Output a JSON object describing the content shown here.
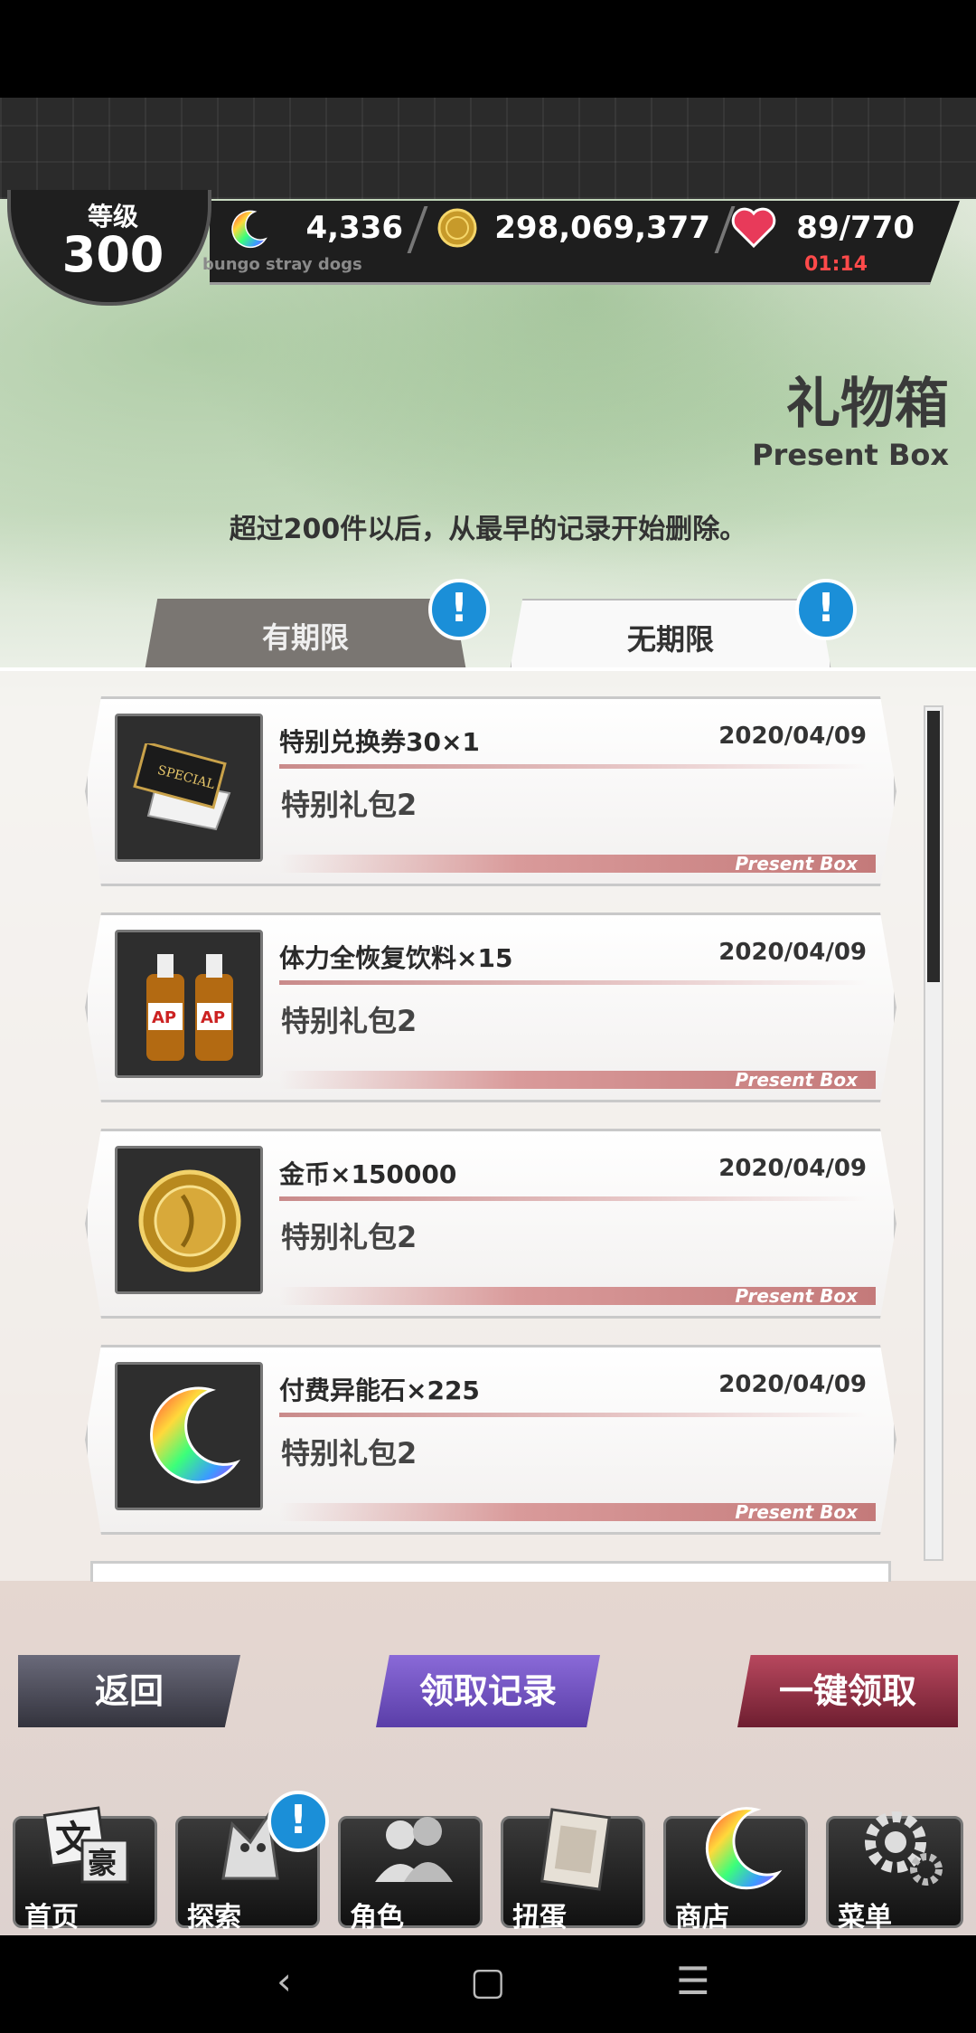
{
  "header": {
    "level_label": "等级",
    "level_value": "300",
    "premium_stones": "4,336",
    "gold": "298,069,377",
    "stamina": "89/770",
    "stamina_timer": "01:14",
    "game_subtitle": "bungo stray dogs"
  },
  "page": {
    "title_cn": "礼物箱",
    "title_en": "Present Box",
    "notice": "超过200件以后，从最早的记录开始删除。"
  },
  "tabs": [
    {
      "label": "有期限",
      "alert": "!"
    },
    {
      "label": "无期限",
      "alert": "!"
    }
  ],
  "items": [
    {
      "name": "特别兑换券30×1",
      "date": "2020/04/09",
      "source": "特别礼包2",
      "tag": "Present Box",
      "icon": "special-ticket-icon"
    },
    {
      "name": "体力全恢复饮料×15",
      "date": "2020/04/09",
      "source": "特别礼包2",
      "tag": "Present Box",
      "icon": "ap-drink-icon"
    },
    {
      "name": "金币×150000",
      "date": "2020/04/09",
      "source": "特别礼包2",
      "tag": "Present Box",
      "icon": "gold-coin-icon"
    },
    {
      "name": "付费异能石×225",
      "date": "2020/04/09",
      "source": "特别礼包2",
      "tag": "Present Box",
      "icon": "crescent-stone-icon"
    }
  ],
  "buttons": {
    "back": "返回",
    "history": "领取记录",
    "claim_all": "一键领取"
  },
  "nav": [
    {
      "label": "首页",
      "icon": "home-icon"
    },
    {
      "label": "探索",
      "icon": "explore-icon",
      "alert": "!"
    },
    {
      "label": "角色",
      "icon": "characters-icon"
    },
    {
      "label": "扭蛋",
      "icon": "gacha-icon"
    },
    {
      "label": "商店",
      "icon": "shop-icon"
    },
    {
      "label": "菜单",
      "icon": "menu-gear-icon"
    }
  ],
  "system_nav": {
    "back": "‹",
    "home": "▢",
    "recents": "☰"
  }
}
